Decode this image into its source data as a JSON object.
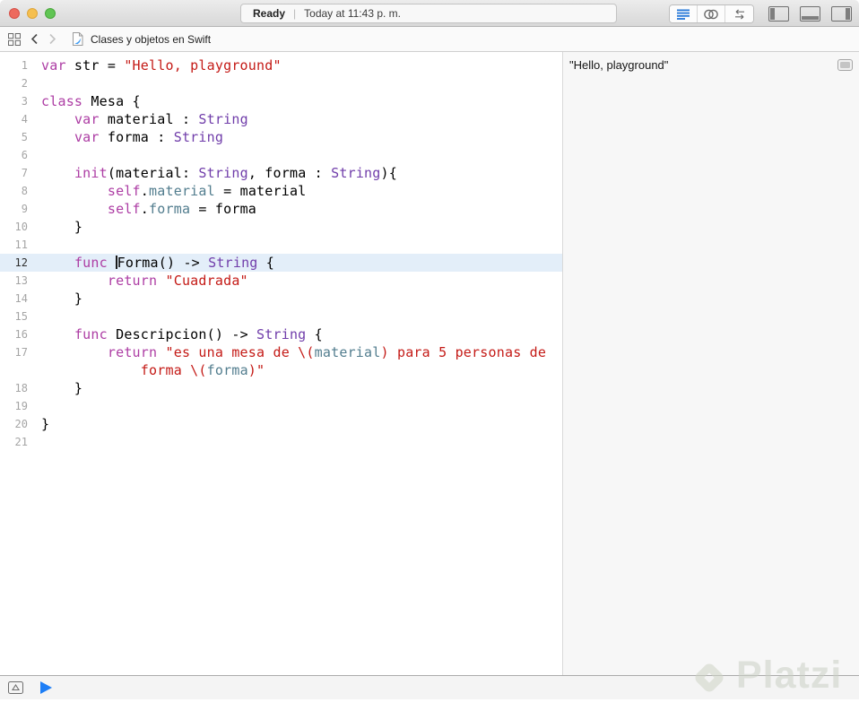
{
  "titlebar": {
    "status": "Ready",
    "separator": "|",
    "time": "Today at 11:43 p. m."
  },
  "jumpbar": {
    "document_title": "Clases y objetos en Swift"
  },
  "editor": {
    "lines": [
      {
        "n": "1",
        "segments": [
          [
            {
              "c": "kw",
              "t": "var"
            },
            {
              "c": "pl",
              "t": " str = "
            },
            {
              "c": "str",
              "t": "\"Hello, playground\""
            }
          ]
        ]
      },
      {
        "n": "2",
        "segments": [
          []
        ]
      },
      {
        "n": "3",
        "segments": [
          [
            {
              "c": "kw",
              "t": "class"
            },
            {
              "c": "pl",
              "t": " Mesa {"
            }
          ]
        ]
      },
      {
        "n": "4",
        "segments": [
          [
            {
              "c": "pl",
              "t": "    "
            },
            {
              "c": "kw",
              "t": "var"
            },
            {
              "c": "pl",
              "t": " material : "
            },
            {
              "c": "ty",
              "t": "String"
            }
          ]
        ]
      },
      {
        "n": "5",
        "segments": [
          [
            {
              "c": "pl",
              "t": "    "
            },
            {
              "c": "kw",
              "t": "var"
            },
            {
              "c": "pl",
              "t": " forma : "
            },
            {
              "c": "ty",
              "t": "String"
            }
          ]
        ]
      },
      {
        "n": "6",
        "segments": [
          []
        ]
      },
      {
        "n": "7",
        "segments": [
          [
            {
              "c": "pl",
              "t": "    "
            },
            {
              "c": "kw",
              "t": "init"
            },
            {
              "c": "pl",
              "t": "(material: "
            },
            {
              "c": "ty",
              "t": "String"
            },
            {
              "c": "pl",
              "t": ", forma : "
            },
            {
              "c": "ty",
              "t": "String"
            },
            {
              "c": "pl",
              "t": "){"
            }
          ]
        ]
      },
      {
        "n": "8",
        "segments": [
          [
            {
              "c": "pl",
              "t": "        "
            },
            {
              "c": "kw",
              "t": "self"
            },
            {
              "c": "pl",
              "t": "."
            },
            {
              "c": "pr",
              "t": "material"
            },
            {
              "c": "pl",
              "t": " = material"
            }
          ]
        ]
      },
      {
        "n": "9",
        "segments": [
          [
            {
              "c": "pl",
              "t": "        "
            },
            {
              "c": "kw",
              "t": "self"
            },
            {
              "c": "pl",
              "t": "."
            },
            {
              "c": "pr",
              "t": "forma"
            },
            {
              "c": "pl",
              "t": " = forma"
            }
          ]
        ]
      },
      {
        "n": "10",
        "segments": [
          [
            {
              "c": "pl",
              "t": "    }"
            }
          ]
        ]
      },
      {
        "n": "11",
        "segments": [
          []
        ]
      },
      {
        "n": "12",
        "highlight": true,
        "segments": [
          [
            {
              "c": "pl",
              "t": "    "
            },
            {
              "c": "kw",
              "t": "func"
            },
            {
              "c": "pl",
              "t": " "
            },
            {
              "c": "caret"
            },
            {
              "c": "pl",
              "t": "Forma() -> "
            },
            {
              "c": "ty",
              "t": "String"
            },
            {
              "c": "pl",
              "t": " {"
            }
          ]
        ]
      },
      {
        "n": "13",
        "segments": [
          [
            {
              "c": "pl",
              "t": "        "
            },
            {
              "c": "kw",
              "t": "return"
            },
            {
              "c": "pl",
              "t": " "
            },
            {
              "c": "str",
              "t": "\"Cuadrada\""
            }
          ]
        ]
      },
      {
        "n": "14",
        "segments": [
          [
            {
              "c": "pl",
              "t": "    }"
            }
          ]
        ]
      },
      {
        "n": "15",
        "segments": [
          []
        ]
      },
      {
        "n": "16",
        "segments": [
          [
            {
              "c": "pl",
              "t": "    "
            },
            {
              "c": "kw",
              "t": "func"
            },
            {
              "c": "pl",
              "t": " Descripcion() -> "
            },
            {
              "c": "ty",
              "t": "String"
            },
            {
              "c": "pl",
              "t": " {"
            }
          ]
        ]
      },
      {
        "n": "17",
        "segments": [
          [
            {
              "c": "pl",
              "t": "        "
            },
            {
              "c": "kw",
              "t": "return"
            },
            {
              "c": "pl",
              "t": " "
            },
            {
              "c": "str",
              "t": "\"es una mesa de \\("
            },
            {
              "c": "pr",
              "t": "material"
            },
            {
              "c": "str",
              "t": ") para 5 personas de"
            }
          ],
          [
            {
              "c": "pl",
              "t": "            "
            },
            {
              "c": "str",
              "t": "forma \\("
            },
            {
              "c": "pr",
              "t": "forma"
            },
            {
              "c": "str",
              "t": ")\""
            }
          ]
        ]
      },
      {
        "n": "18",
        "segments": [
          [
            {
              "c": "pl",
              "t": "    }"
            }
          ]
        ]
      },
      {
        "n": "19",
        "segments": [
          []
        ]
      },
      {
        "n": "20",
        "segments": [
          [
            {
              "c": "pl",
              "t": "}"
            }
          ]
        ]
      },
      {
        "n": "21",
        "segments": [
          []
        ]
      }
    ]
  },
  "results": {
    "items": [
      {
        "text": "\"Hello, playground\""
      }
    ]
  },
  "colors": {
    "kw": "#AD3DA4",
    "pl": "#000000",
    "str": "#C41A16",
    "ty": "#703DAA",
    "pr": "#527D8E",
    "line_highlight": "#E3EEF9",
    "accent_blue": "#1D7EF6",
    "editor_icon_blue": "#2577D8"
  },
  "watermark": {
    "text": "Platzi"
  }
}
